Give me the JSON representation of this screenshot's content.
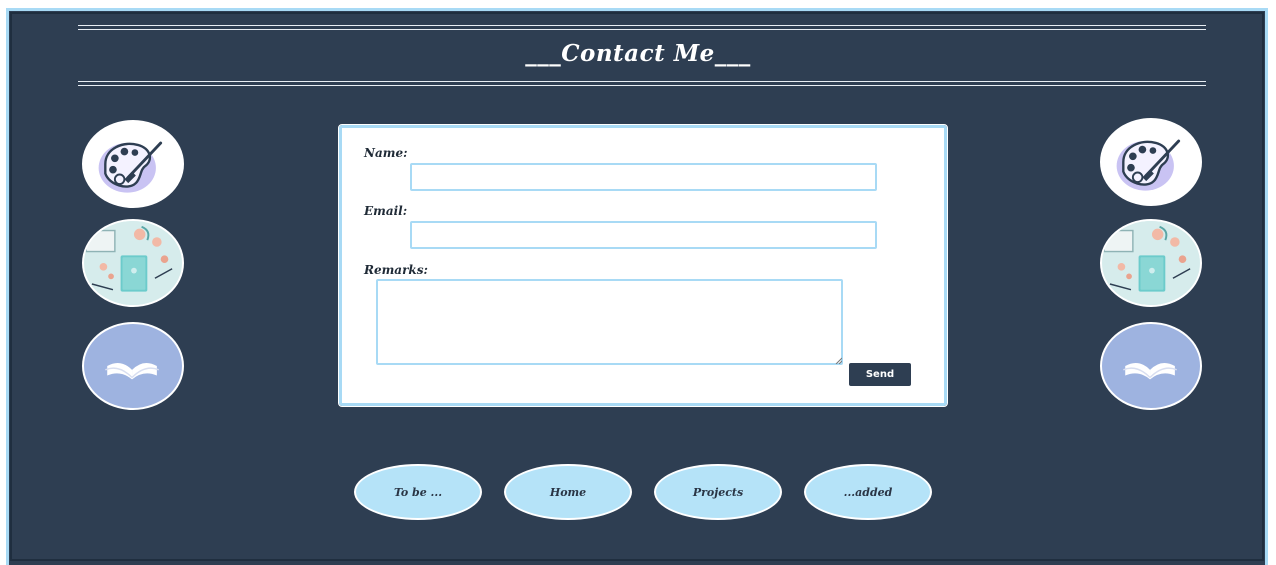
{
  "header": {
    "title": "___Contact Me___"
  },
  "form": {
    "name_label": "Name:",
    "email_label": "Email:",
    "remarks_label": "Remarks:",
    "name_value": "",
    "email_value": "",
    "remarks_value": "",
    "send_label": "Send"
  },
  "nav": {
    "items": [
      {
        "label": "To be ..."
      },
      {
        "label": "Home"
      },
      {
        "label": "Projects"
      },
      {
        "label": "...added"
      }
    ]
  },
  "side_images": [
    "palette-icon",
    "desk-illustration",
    "open-book-icon"
  ],
  "colors": {
    "background": "#2e3e52",
    "accent": "#a8daf5",
    "nav_button": "#b5e3f8",
    "send_button": "#2e3e52"
  }
}
